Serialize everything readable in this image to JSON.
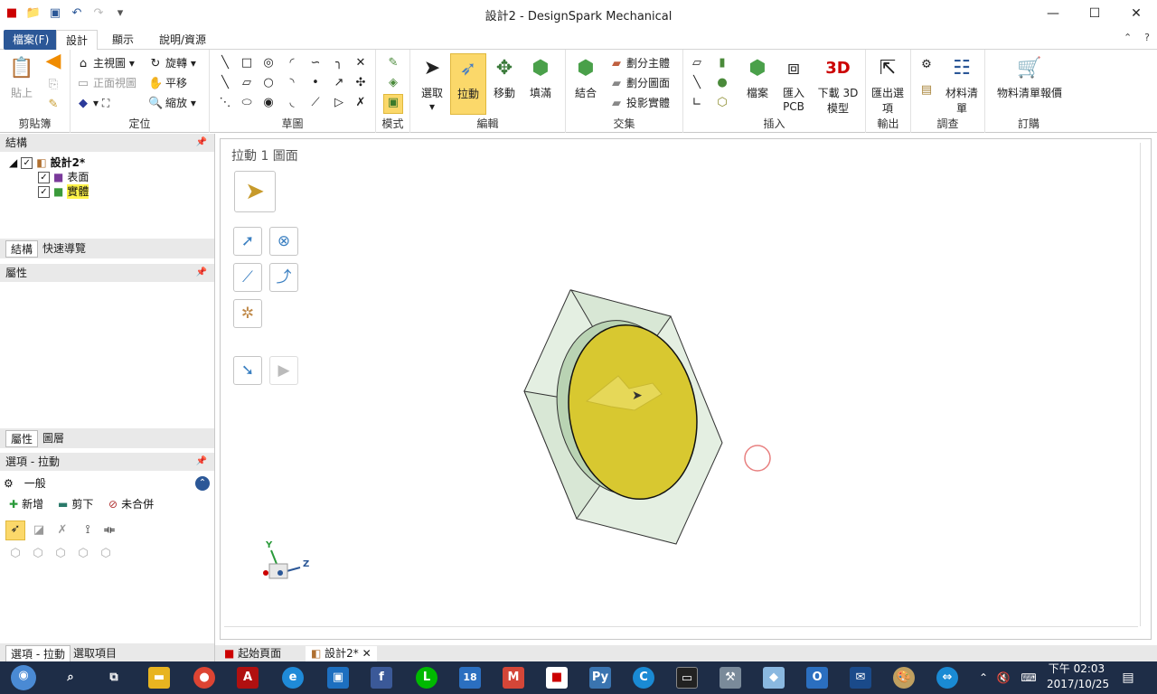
{
  "window": {
    "title": "設計2 - DesignSpark Mechanical",
    "minimize": "—",
    "maximize": "☐",
    "close": "✕"
  },
  "qat": {
    "items": [
      "app-logo-icon",
      "open-folder-icon",
      "save-icon",
      "undo-icon",
      "redo-icon",
      "customize-icon"
    ]
  },
  "tabs": [
    {
      "label": "檔案(F)"
    },
    {
      "label": "設計"
    },
    {
      "label": "顯示"
    },
    {
      "label": "說明/資源"
    }
  ],
  "ribbon": {
    "clipboard": {
      "paste": "貼上",
      "label": "剪貼簿"
    },
    "orient": {
      "home": "主視圖",
      "front": "正面視圖",
      "rotate": "旋轉",
      "pan": "平移",
      "zoom": "縮放",
      "label": "定位"
    },
    "sketch": {
      "label": "草圖"
    },
    "mode": {
      "label": "模式"
    },
    "edit": {
      "select": "選取",
      "pull": "拉動",
      "move": "移動",
      "fill": "填滿",
      "label": "編輯"
    },
    "intersect": {
      "combine": "結合",
      "split_body": "劃分主體",
      "split_face": "劃分圖面",
      "project": "投影實體",
      "label": "交集"
    },
    "insert": {
      "file": "檔案",
      "pcb": "匯入PCB",
      "download3d": "下載 3D模型",
      "label": "插入"
    },
    "output": {
      "export": "匯出選項",
      "label": "輸出"
    },
    "investigate": {
      "bom": "材料清單",
      "label": "調查"
    },
    "order": {
      "bom_report": "物料清單報價",
      "label": "訂購"
    }
  },
  "structure": {
    "title": "結構",
    "root": "設計2*",
    "items": [
      "表面",
      "實體"
    ]
  },
  "struct_tabs": [
    "結構",
    "快速導覽"
  ],
  "properties": {
    "title": "屬性"
  },
  "prop_tabs": [
    "屬性",
    "圖層"
  ],
  "options": {
    "title": "選項 - 拉動",
    "section": "一般",
    "add": "新增",
    "cut": "剪下",
    "nomerge": "未合併"
  },
  "bottom_tabs": [
    "選項 - 拉動",
    "選取項目"
  ],
  "canvas": {
    "title": "拉動 1 圖面"
  },
  "axes": {
    "y": "Y",
    "z": "Z"
  },
  "doc_tabs": [
    "起始頁面",
    "設計2*"
  ],
  "clock": {
    "time": "下午 02:03",
    "date": "2017/10/25"
  },
  "taskbar": {
    "calendar_day": "18",
    "icons": [
      "start",
      "search",
      "task-view",
      "file-explorer",
      "chrome",
      "acrobat",
      "ie",
      "store",
      "facebook",
      "line",
      "calendar",
      "gmail",
      "designspark",
      "python",
      "c-app",
      "terminal",
      "tools",
      "kite",
      "outlook",
      "mail",
      "paint",
      "teamviewer"
    ]
  }
}
